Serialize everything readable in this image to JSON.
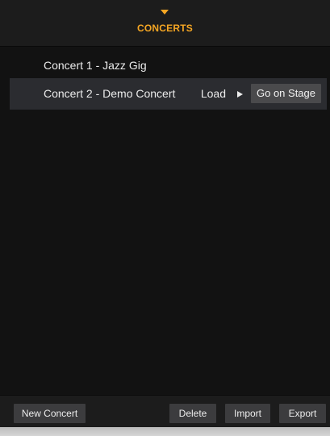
{
  "header": {
    "title": "CONCERTS",
    "caret_icon": "chevron-down-icon",
    "accent_color": "#f5a623"
  },
  "concerts": [
    {
      "name": "Concert 1 - Jazz Gig",
      "selected": false
    },
    {
      "name": "Concert 2 - Demo Concert",
      "selected": true
    }
  ],
  "selected_row": {
    "load_label": "Load",
    "play_icon": "play-icon",
    "go_on_stage_label": "Go on Stage"
  },
  "footer": {
    "new_concert_label": "New Concert",
    "delete_label": "Delete",
    "import_label": "Import",
    "export_label": "Export"
  }
}
